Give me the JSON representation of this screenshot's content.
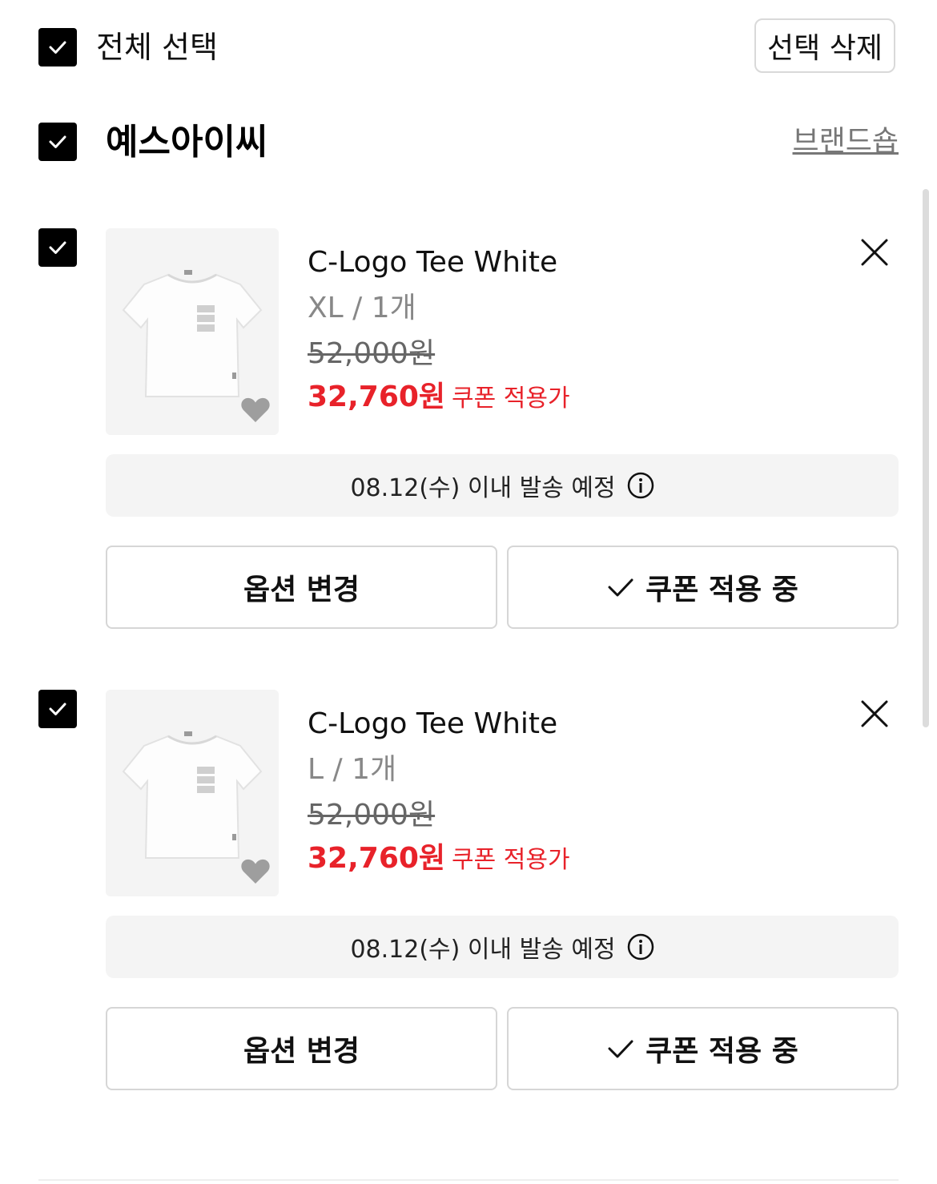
{
  "header": {
    "select_all_label": "전체 선택",
    "delete_selected_label": "선택 삭제"
  },
  "brand": {
    "name": "예스아이씨",
    "shop_link": "브랜드숍"
  },
  "items": [
    {
      "name": "C-Logo Tee White",
      "option": "XL / 1개",
      "original_price": "52,000원",
      "sale_price": "32,760원",
      "coupon_note": "쿠폰 적용가",
      "shipping": "08.12(수) 이내 발송 예정",
      "option_button": "옵션 변경",
      "coupon_button": "쿠폰 적용 중",
      "checked": true
    },
    {
      "name": "C-Logo Tee White",
      "option": "L / 1개",
      "original_price": "52,000원",
      "sale_price": "32,760원",
      "coupon_note": "쿠폰 적용가",
      "shipping": "08.12(수) 이내 발송 예정",
      "option_button": "옵션 변경",
      "coupon_button": "쿠폰 적용 중",
      "checked": true
    }
  ],
  "icons": {
    "checkbox": "checkmark-icon",
    "close": "close-icon",
    "info": "info-icon",
    "wishlist": "heart-icon",
    "coupon_check": "check-icon"
  },
  "colors": {
    "price_red": "#e8222a",
    "checkbox_black": "#000000",
    "muted_gray": "#888888"
  }
}
